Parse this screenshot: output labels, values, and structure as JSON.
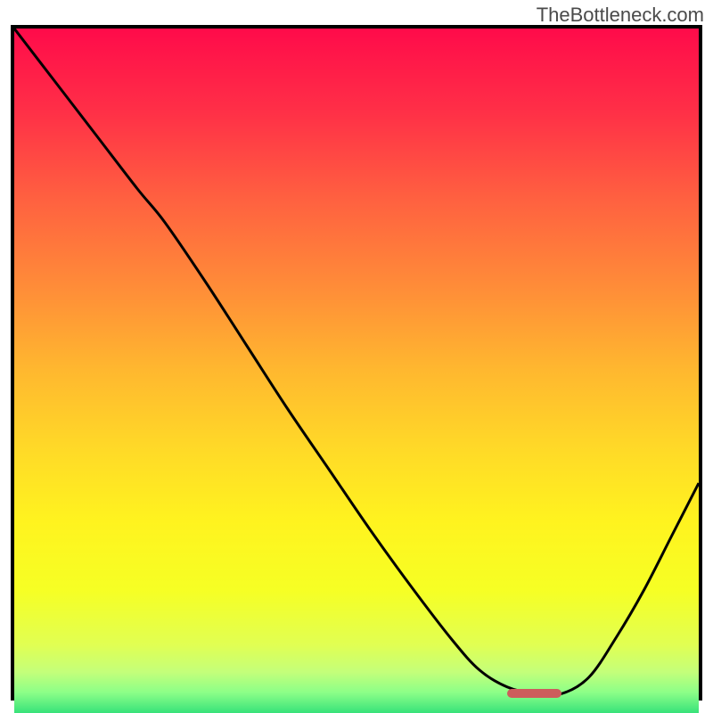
{
  "watermark": "TheBottleneck.com",
  "chart_data": {
    "type": "line",
    "title": "",
    "xlabel": "",
    "ylabel": "",
    "xlim": [
      0,
      100
    ],
    "ylim": [
      0,
      100
    ],
    "series": [
      {
        "name": "curve",
        "x": [
          0,
          6,
          12,
          18,
          22,
          28,
          34,
          40,
          46,
          52,
          58,
          64,
          68,
          72,
          76,
          80,
          84,
          88,
          92,
          96,
          100
        ],
        "y": [
          100,
          92,
          84,
          76,
          71,
          62,
          52.5,
          43,
          34,
          25,
          16.5,
          8.5,
          4,
          1.5,
          0.5,
          0.5,
          3,
          9,
          16,
          24,
          32
        ]
      }
    ],
    "marker": {
      "x_start": 72,
      "x_end": 80,
      "y": 0.5,
      "color": "#cd5c5c"
    },
    "gradient": {
      "stops": [
        {
          "offset": 0.0,
          "color": "#ff0b4a"
        },
        {
          "offset": 0.12,
          "color": "#ff2f47"
        },
        {
          "offset": 0.25,
          "color": "#ff6140"
        },
        {
          "offset": 0.38,
          "color": "#ff8d38"
        },
        {
          "offset": 0.5,
          "color": "#ffb82f"
        },
        {
          "offset": 0.62,
          "color": "#ffdb27"
        },
        {
          "offset": 0.72,
          "color": "#fff31f"
        },
        {
          "offset": 0.82,
          "color": "#f6ff24"
        },
        {
          "offset": 0.9,
          "color": "#e1ff52"
        },
        {
          "offset": 0.94,
          "color": "#c4ff7a"
        },
        {
          "offset": 0.97,
          "color": "#8cff88"
        },
        {
          "offset": 1.0,
          "color": "#38e27a"
        }
      ]
    }
  }
}
